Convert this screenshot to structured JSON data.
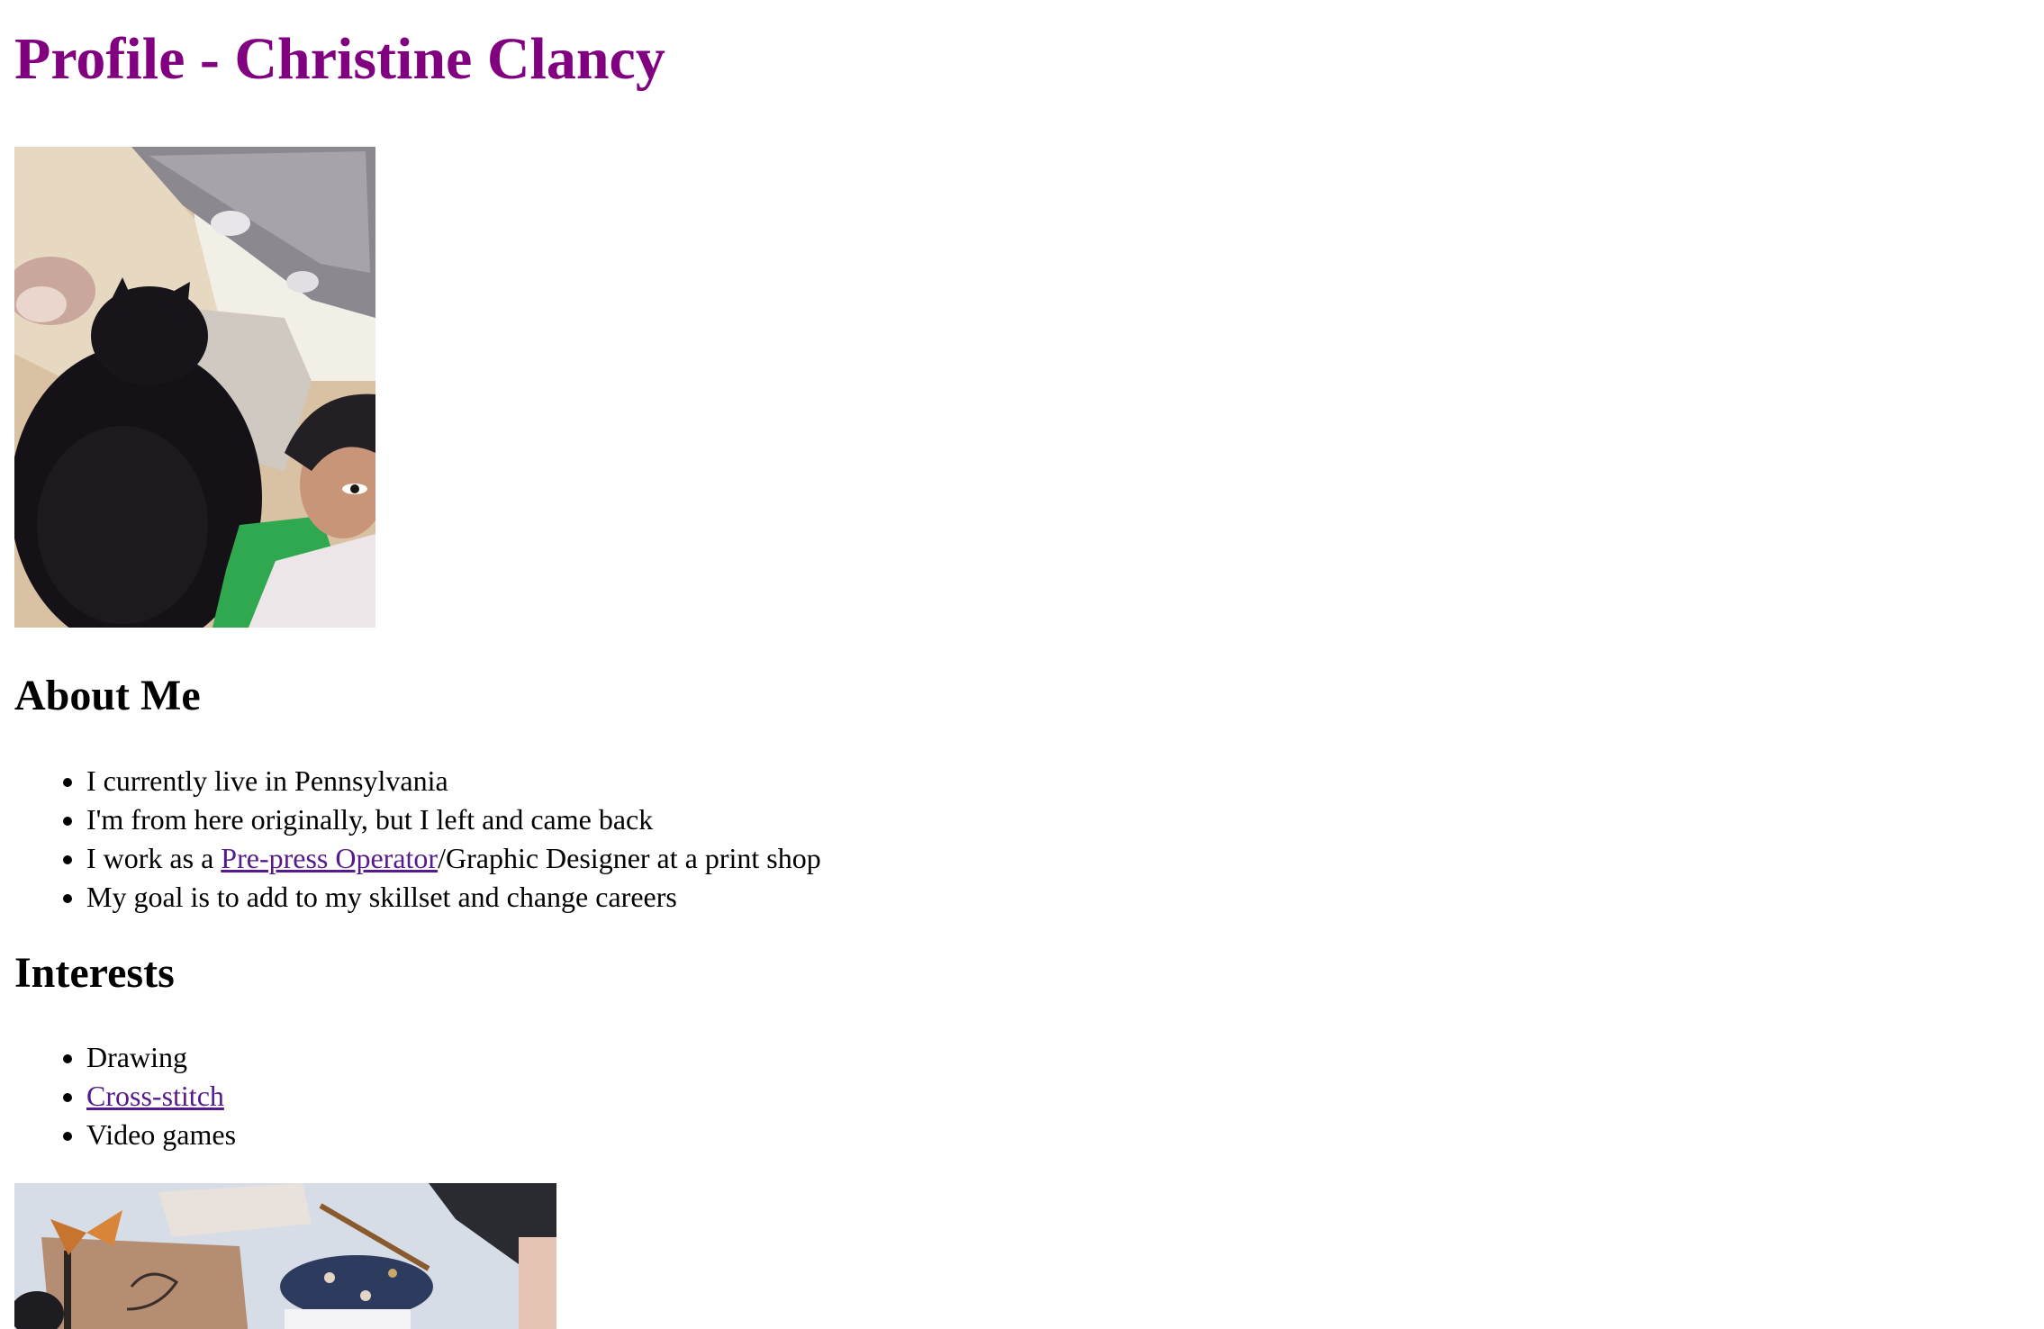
{
  "page": {
    "title": "Profile - Christine Clancy"
  },
  "about": {
    "heading": "About Me",
    "items": {
      "0": {
        "text": "I currently live in Pennsylvania"
      },
      "1": {
        "text": "I'm from here originally, but I left and came back"
      },
      "2": {
        "prefix": "I work as a ",
        "link": "Pre-press Operator",
        "suffix": "/Graphic Designer at a print shop"
      },
      "3": {
        "text": "My goal is to add to my skillset and change careers"
      }
    }
  },
  "interests": {
    "heading": "Interests",
    "items": {
      "0": {
        "text": "Drawing"
      },
      "1": {
        "link": "Cross-stitch"
      },
      "2": {
        "text": "Video games"
      }
    }
  },
  "colors": {
    "title": "#800080",
    "link": "#551a8b",
    "text": "#000000",
    "background": "#ffffff"
  }
}
